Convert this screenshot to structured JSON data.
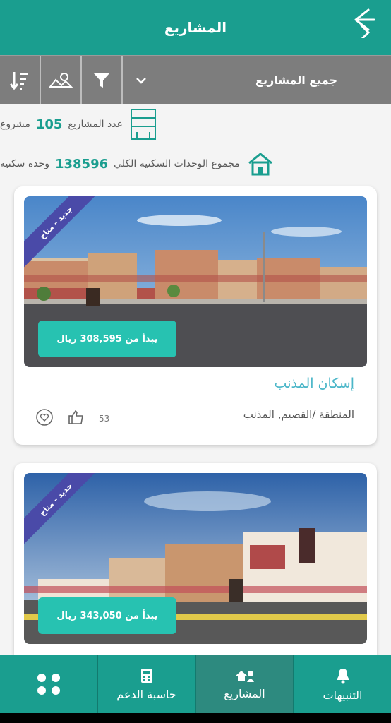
{
  "header": {
    "title": "المشاريع"
  },
  "toolbar": {
    "dropdown_label": "جميع المشاريع"
  },
  "stats": {
    "projects_label": "عدد المشاريع",
    "projects_count": "105",
    "projects_unit": "مشروع",
    "units_label": "مجموع الوحدات السكنية الكلي",
    "units_count": "138596",
    "units_unit": "وحده سكنية"
  },
  "cards": [
    {
      "badge": "جديد - متاح",
      "price": "يبدأ من 308,595 ريال",
      "title": "إسكان المذنب",
      "region": "المنطقة /القصيم, المذنب",
      "likes": "53"
    },
    {
      "badge": "جديد - متاح",
      "price": "يبدأ من 343,050 ريال"
    }
  ],
  "nav": {
    "apps": "",
    "calculator": "حاسبة الدعم",
    "projects": "المشاريع",
    "notifications": "التنبيهات"
  },
  "colors": {
    "primary": "#1a9e8f",
    "accent": "#27c2b1",
    "ribbon": "#4a4aa8"
  }
}
